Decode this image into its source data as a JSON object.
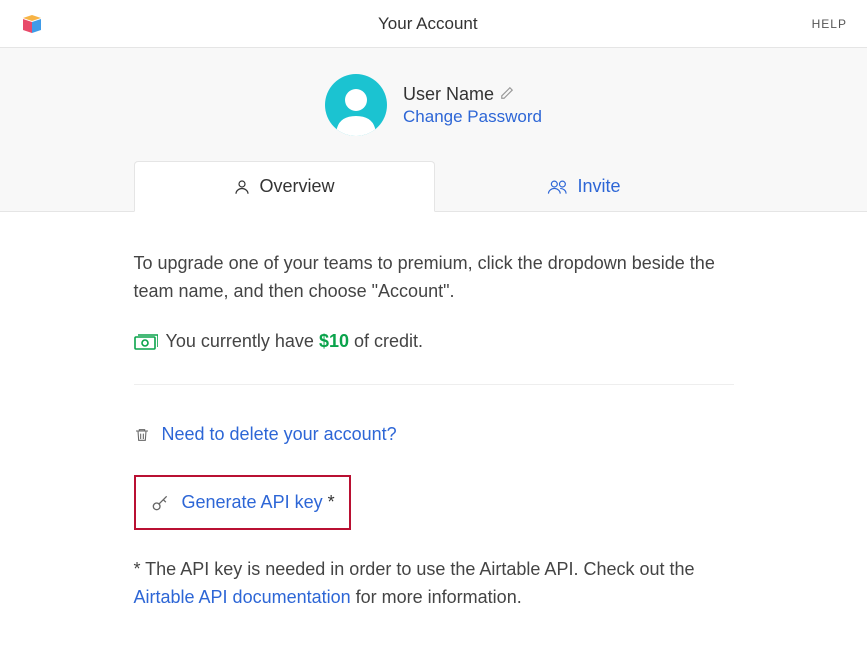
{
  "header": {
    "title": "Your Account",
    "help": "HELP"
  },
  "profile": {
    "username": "User Name",
    "change_password": "Change Password"
  },
  "tabs": {
    "overview": "Overview",
    "invite": "Invite"
  },
  "content": {
    "upgrade_text": "To upgrade one of your teams to premium, click the dropdown beside the team name, and then choose \"Account\".",
    "credit_prefix": "You currently have ",
    "credit_amount": "$10",
    "credit_suffix": " of credit.",
    "delete_account": "Need to delete your account?",
    "generate_api_key": "Generate API key",
    "asterisk": "*",
    "note_prefix": "* The API key is needed in order to use the Airtable API. Check out the ",
    "note_link": "Airtable API documentation",
    "note_suffix": " for more information."
  }
}
